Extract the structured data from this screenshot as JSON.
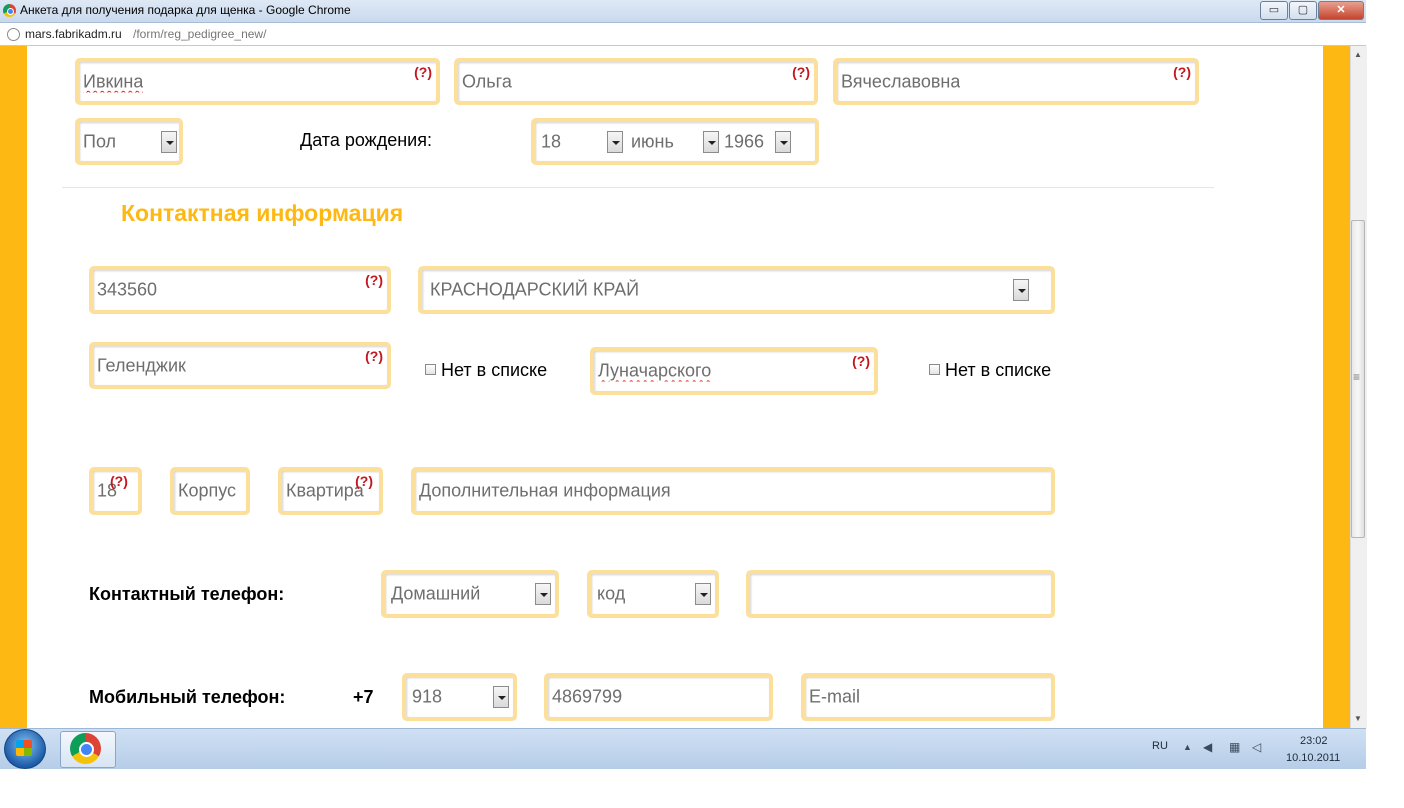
{
  "window": {
    "title": "Анкета для получения подарка для щенка - Google Chrome",
    "minimize_symbol": "▭",
    "maximize_symbol": "▢",
    "close_symbol": "✕"
  },
  "address": {
    "host": "mars.fabrikadm.ru",
    "path": "/form/reg_pedigree_new/"
  },
  "scrollbar": {
    "up_symbol": "▲",
    "down_symbol": "▼",
    "grip_symbol": "≡"
  },
  "hint_marker": "(?)",
  "personal": {
    "last_name": "Ивкина",
    "first_name": "Ольга",
    "middle_name": "Вячеславовна",
    "gender": "Пол",
    "birth_label": "Дата рождения:",
    "birth_day": "18",
    "birth_month": "июнь",
    "birth_year": "1966"
  },
  "contact": {
    "section_title": "Контактная информация",
    "postal_code": "343560",
    "region": "КРАСНОДАРСКИЙ КРАЙ",
    "city": "Геленджик",
    "not_in_list": "Нет в списке",
    "street": "Луначарского",
    "house": "18",
    "building_placeholder": "Корпус",
    "apartment_placeholder": "Квартира",
    "extra_placeholder": "Дополнительная информация"
  },
  "phone": {
    "contact_label": "Контактный телефон:",
    "phone_type": "Домашний",
    "code": "код",
    "number": "",
    "mobile_label": "Мобильный телефон:",
    "country_code": "+7",
    "mobile_code": "918",
    "mobile_number": "4869799",
    "email_placeholder": "E-mail"
  },
  "taskbar": {
    "language": "RU",
    "time": "23:02",
    "date": "10.10.2011"
  }
}
